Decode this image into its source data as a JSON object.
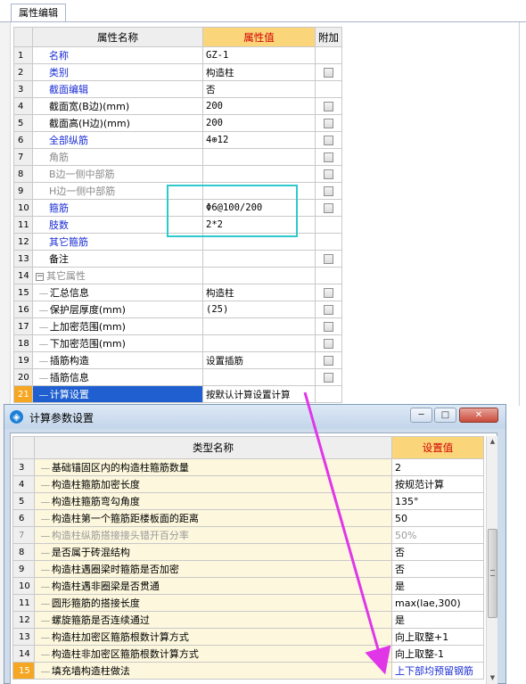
{
  "panel": {
    "tab_label": "属性编辑"
  },
  "prop_headers": {
    "name": "属性名称",
    "value": "属性值",
    "extra": "附加"
  },
  "props": [
    {
      "num": "1",
      "name": "名称",
      "value": "GZ-1",
      "style": "blue",
      "checkbox": false
    },
    {
      "num": "2",
      "name": "类别",
      "value": "构造柱",
      "style": "blue",
      "checkbox": true
    },
    {
      "num": "3",
      "name": "截面编辑",
      "value": "否",
      "style": "blue",
      "checkbox": false
    },
    {
      "num": "4",
      "name": "截面宽(B边)(mm)",
      "value": "200",
      "style": "normal",
      "checkbox": true
    },
    {
      "num": "5",
      "name": "截面高(H边)(mm)",
      "value": "200",
      "style": "normal",
      "checkbox": true
    },
    {
      "num": "6",
      "name": "全部纵筋",
      "value": "4⊕12",
      "style": "blue",
      "checkbox": true
    },
    {
      "num": "7",
      "name": "角筋",
      "value": "",
      "style": "gray",
      "checkbox": true
    },
    {
      "num": "8",
      "name": "B边一侧中部筋",
      "value": "",
      "style": "gray",
      "checkbox": true
    },
    {
      "num": "9",
      "name": "H边一侧中部筋",
      "value": "",
      "style": "gray",
      "checkbox": true
    },
    {
      "num": "10",
      "name": "箍筋",
      "value": "Φ6@100/200",
      "style": "blue",
      "checkbox": true
    },
    {
      "num": "11",
      "name": "肢数",
      "value": "2*2",
      "style": "blue",
      "checkbox": false
    },
    {
      "num": "12",
      "name": "其它箍筋",
      "value": "",
      "style": "blue",
      "checkbox": false
    },
    {
      "num": "13",
      "name": "备注",
      "value": "",
      "style": "normal",
      "checkbox": true
    },
    {
      "num": "14",
      "name": "其它属性",
      "value": "",
      "style": "group",
      "checkbox": false
    },
    {
      "num": "15",
      "name": "汇总信息",
      "value": "构造柱",
      "style": "child",
      "checkbox": true
    },
    {
      "num": "16",
      "name": "保护层厚度(mm)",
      "value": "(25)",
      "style": "child",
      "checkbox": true
    },
    {
      "num": "17",
      "name": "上加密范围(mm)",
      "value": "",
      "style": "child",
      "checkbox": true
    },
    {
      "num": "18",
      "name": "下加密范围(mm)",
      "value": "",
      "style": "child",
      "checkbox": true
    },
    {
      "num": "19",
      "name": "插筋构造",
      "value": "设置插筋",
      "style": "child",
      "checkbox": true
    },
    {
      "num": "20",
      "name": "插筋信息",
      "value": "",
      "style": "child",
      "checkbox": true
    },
    {
      "num": "21",
      "name": "计算设置",
      "value": "按默认计算设置计算",
      "style": "selected",
      "checkbox": false
    }
  ],
  "group_expander": "−",
  "tree_connector": "——",
  "dialog": {
    "title": "计算参数设置",
    "icon": "gear-app-icon",
    "min": "─",
    "max": "□",
    "close": "✕",
    "headers": {
      "name": "类型名称",
      "value": "设置值"
    }
  },
  "calc_rows": [
    {
      "num": "3",
      "name": "基础锚固区内的构造柱箍筋数量",
      "value": "2",
      "gray": false,
      "hilite": false
    },
    {
      "num": "4",
      "name": "构造柱箍筋加密长度",
      "value": "按规范计算",
      "gray": false,
      "hilite": false
    },
    {
      "num": "5",
      "name": "构造柱箍筋弯勾角度",
      "value": "135°",
      "gray": false,
      "hilite": false
    },
    {
      "num": "6",
      "name": "构造柱第一个箍筋距楼板面的距离",
      "value": "50",
      "gray": false,
      "hilite": false
    },
    {
      "num": "7",
      "name": "构造柱纵筋搭接接头错开百分率",
      "value": "50%",
      "gray": true,
      "hilite": false
    },
    {
      "num": "8",
      "name": "是否属于砖混结构",
      "value": "否",
      "gray": false,
      "hilite": false
    },
    {
      "num": "9",
      "name": "构造柱遇圈梁时箍筋是否加密",
      "value": "否",
      "gray": false,
      "hilite": false
    },
    {
      "num": "10",
      "name": "构造柱遇非圈梁是否贯通",
      "value": "是",
      "gray": false,
      "hilite": false
    },
    {
      "num": "11",
      "name": "圆形箍筋的搭接长度",
      "value": "max(lae,300)",
      "gray": false,
      "hilite": false
    },
    {
      "num": "12",
      "name": "螺旋箍筋是否连续通过",
      "value": "是",
      "gray": false,
      "hilite": false
    },
    {
      "num": "13",
      "name": "构造柱加密区箍筋根数计算方式",
      "value": "向上取整+1",
      "gray": false,
      "hilite": false
    },
    {
      "num": "14",
      "name": "构造柱非加密区箍筋根数计算方式",
      "value": "向上取整-1",
      "gray": false,
      "hilite": false
    },
    {
      "num": "15",
      "name": "填充墙构造柱做法",
      "value": "上下部均预留钢筋",
      "gray": false,
      "hilite": true
    }
  ],
  "scrollbar": {
    "up": "▲",
    "down": "▼"
  },
  "colors": {
    "accent_arrow": "#e036e8",
    "highlight_box": "#2ec9cf",
    "header_value_bg": "#fad57a",
    "selected_row": "#1f5fd0"
  }
}
